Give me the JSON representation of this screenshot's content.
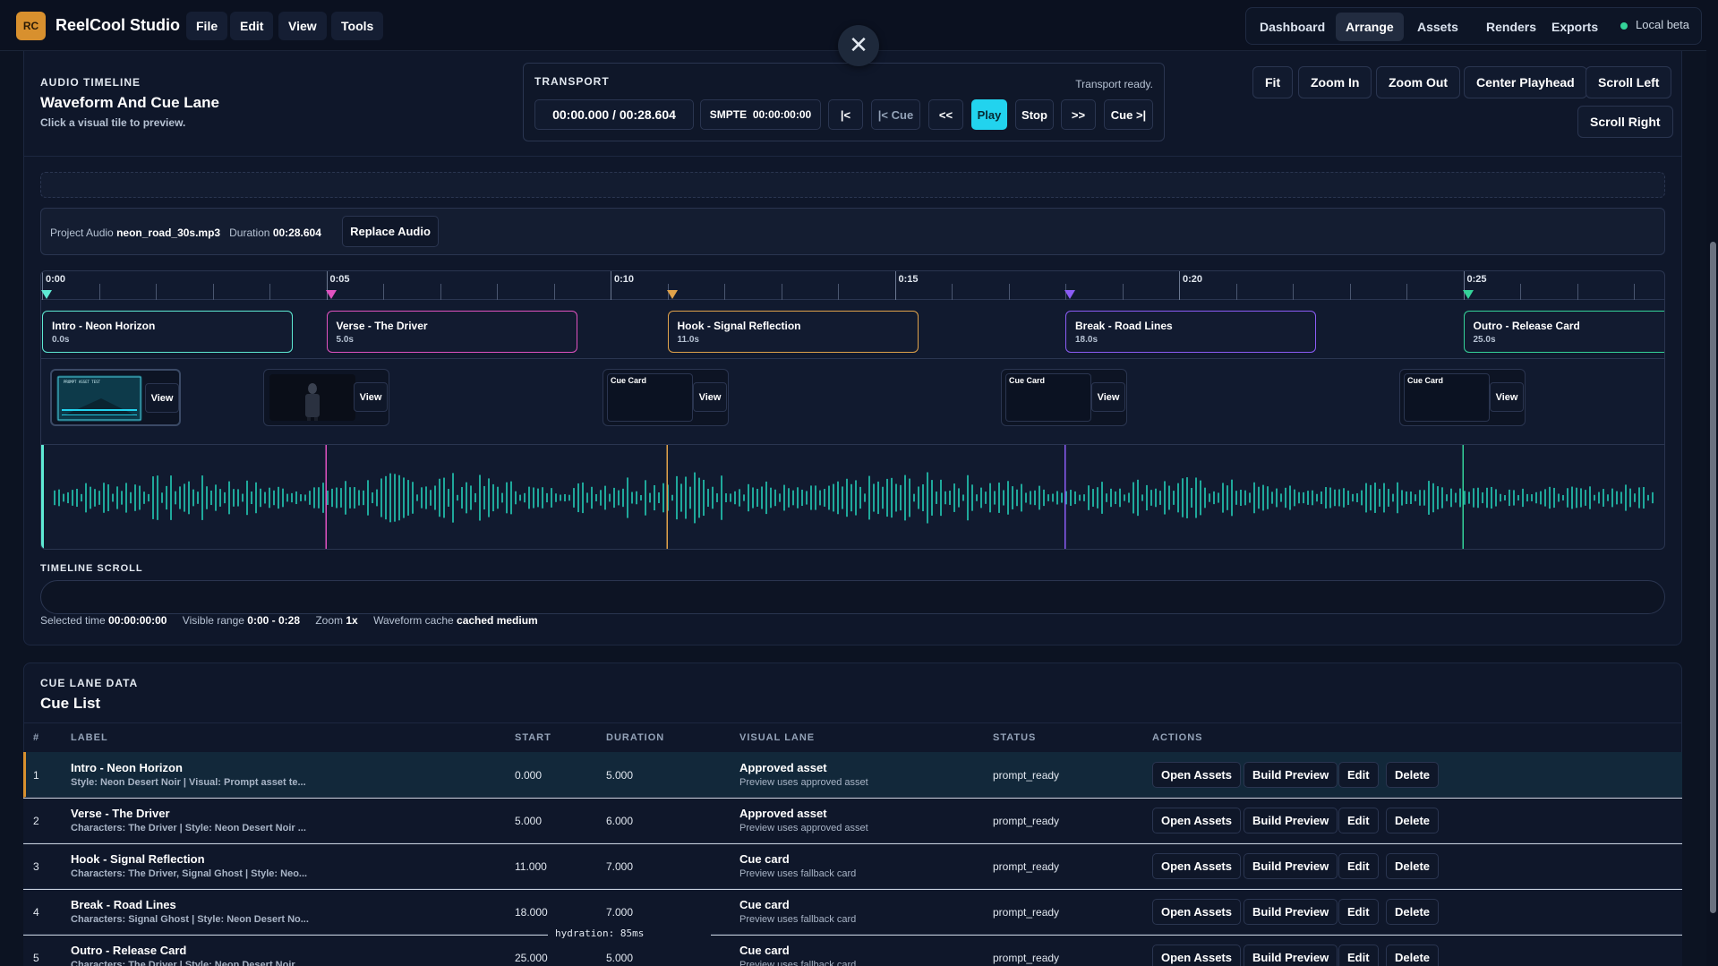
{
  "app": {
    "badge": "RC",
    "name": "ReelCool Studio"
  },
  "menu": [
    "File",
    "Edit",
    "View",
    "Tools"
  ],
  "nav": {
    "items": [
      "Dashboard",
      "Arrange",
      "Assets",
      "Renders",
      "Exports"
    ],
    "active": "Arrange",
    "env": "Local beta"
  },
  "close_glyph": "✕",
  "timeline_header": {
    "label": "AUDIO TIMELINE",
    "title": "Waveform And Cue Lane",
    "subtitle": "Click a visual tile to preview."
  },
  "transport": {
    "label": "TRANSPORT",
    "status": "Transport ready.",
    "time": "00:00.000 / 00:28.604",
    "smpte_label": "SMPTE",
    "smpte_value": "00:00:00:00",
    "buttons": [
      "|<",
      "|< Cue",
      "<<",
      "Play",
      "Stop",
      ">>",
      "Cue >|"
    ]
  },
  "view_controls": [
    "Fit",
    "Zoom In",
    "Zoom Out",
    "Center Playhead",
    "Scroll Left",
    "Scroll Right"
  ],
  "audio": {
    "prefix": "Project Audio",
    "file": "neon_road_30s.mp3",
    "duration_label": "Duration",
    "duration": "00:28.604",
    "replace_label": "Replace Audio"
  },
  "ruler": {
    "labels": [
      "0:00",
      "0:05",
      "0:10",
      "0:15",
      "0:20",
      "0:25"
    ],
    "total_seconds": 28.604
  },
  "cues": [
    {
      "name": "Intro - Neon Horizon",
      "time": "0.0s",
      "start": 0,
      "color": "#5eead4"
    },
    {
      "name": "Verse - The Driver",
      "time": "5.0s",
      "start": 5,
      "color": "#e052c0"
    },
    {
      "name": "Hook - Signal Reflection",
      "time": "11.0s",
      "start": 11,
      "color": "#e0a24a"
    },
    {
      "name": "Break - Road Lines",
      "time": "18.0s",
      "start": 18,
      "color": "#8b5cf6"
    },
    {
      "name": "Outro - Release Card",
      "time": "25.0s",
      "start": 25,
      "color": "#34d399"
    }
  ],
  "visual_tiles": [
    {
      "kind": "image",
      "view": "View",
      "thumb_text": "PROMPT ASSET TEST"
    },
    {
      "kind": "image",
      "view": "View"
    },
    {
      "kind": "card",
      "label": "Cue Card",
      "view": "View"
    },
    {
      "kind": "card",
      "label": "Cue Card",
      "view": "View"
    },
    {
      "kind": "card",
      "label": "Cue Card",
      "view": "View"
    }
  ],
  "scroll": {
    "label": "TIMELINE SCROLL"
  },
  "status": {
    "selected_label": "Selected time",
    "selected_value": "00:00:00:00",
    "range_label": "Visible range",
    "range_value": "0:00 - 0:28",
    "zoom_label": "Zoom",
    "zoom_value": "1x",
    "cache_label": "Waveform cache",
    "cache_value": "cached medium"
  },
  "cue_list": {
    "label": "CUE LANE DATA",
    "title": "Cue List",
    "columns": [
      "#",
      "LABEL",
      "START",
      "DURATION",
      "VISUAL LANE",
      "STATUS",
      "ACTIONS"
    ],
    "actions": [
      "Open Assets",
      "Build Preview",
      "Edit",
      "Delete"
    ],
    "rows": [
      {
        "n": "1",
        "label": "Intro - Neon Horizon",
        "sub": "Style: Neon Desert Noir | Visual: Prompt asset te...",
        "start": "0.000",
        "duration": "5.000",
        "lane": "Approved asset",
        "lane_sub": "Preview uses approved asset",
        "status": "prompt_ready"
      },
      {
        "n": "2",
        "label": "Verse - The Driver",
        "sub": "Characters: The Driver | Style: Neon Desert Noir ...",
        "start": "5.000",
        "duration": "6.000",
        "lane": "Approved asset",
        "lane_sub": "Preview uses approved asset",
        "status": "prompt_ready"
      },
      {
        "n": "3",
        "label": "Hook - Signal Reflection",
        "sub": "Characters: The Driver, Signal Ghost | Style: Neo...",
        "start": "11.000",
        "duration": "7.000",
        "lane": "Cue card",
        "lane_sub": "Preview uses fallback card",
        "status": "prompt_ready"
      },
      {
        "n": "4",
        "label": "Break - Road Lines",
        "sub": "Characters: Signal Ghost | Style: Neon Desert No...",
        "start": "18.000",
        "duration": "7.000",
        "lane": "Cue card",
        "lane_sub": "Preview uses fallback card",
        "status": "prompt_ready"
      },
      {
        "n": "5",
        "label": "Outro - Release Card",
        "sub": "Characters: The Driver | Style: Neon Desert Noir",
        "start": "25.000",
        "duration": "5.000",
        "lane": "Cue card",
        "lane_sub": "Preview uses fallback card",
        "status": "prompt_ready"
      }
    ]
  },
  "hydration": "hydration: 85ms",
  "colors": {
    "accent": "#22d3ee",
    "brand": "#d8902e",
    "ok": "#34d399"
  }
}
